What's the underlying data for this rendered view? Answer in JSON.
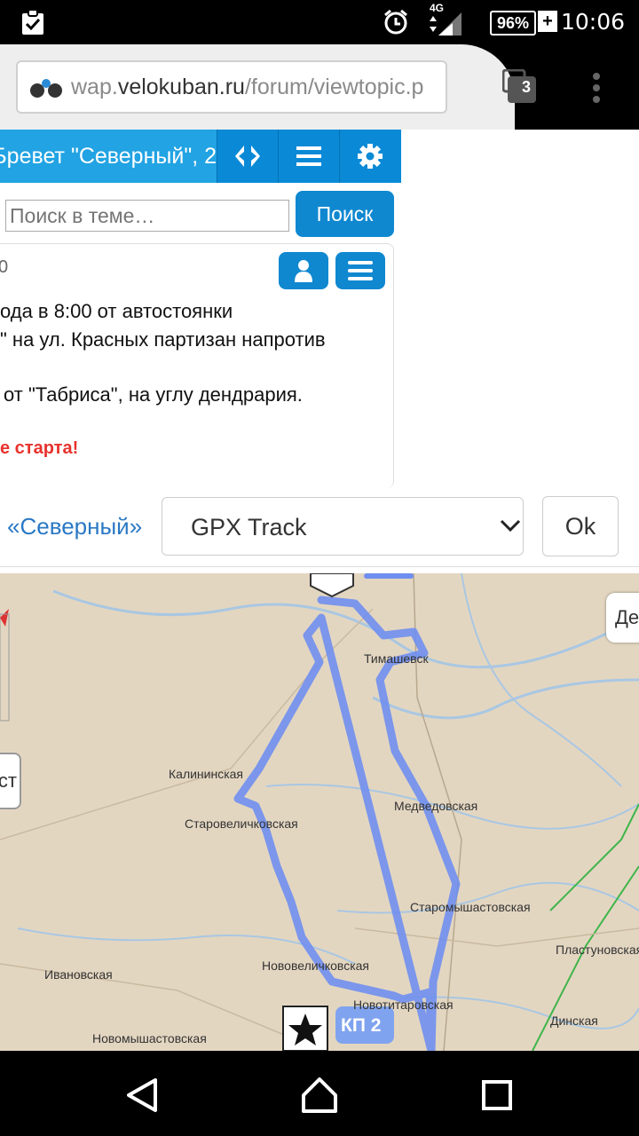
{
  "status_bar": {
    "time": "10:06",
    "battery": "96%",
    "network": "4G",
    "icons": [
      "clipboard-check-icon",
      "alarm-icon",
      "signal-icon",
      "battery-icon"
    ]
  },
  "browser": {
    "url_prefix": "wap.",
    "url_domain": "velokuban.ru",
    "url_path": "/forum/viewtopic.p",
    "tab_count": "3"
  },
  "topic": {
    "title": "Бревет \"Северный\", 2"
  },
  "search": {
    "placeholder": "Поиск в теме…",
    "button_label": "Поиск"
  },
  "post": {
    "meta": "0",
    "lines": [
      "ода в 8:00 от автостоянки",
      "\" на ул. Красных партизан напротив",
      "от \"Табриса\", на углу дендрария."
    ],
    "warning": "е старта!"
  },
  "gpx": {
    "link_label": "«Северный»",
    "select_value": "GPX Track",
    "ok_label": "Ok"
  },
  "map": {
    "labels": {
      "timashevsk": "Тимашевск",
      "kalininskaya": "Калининская",
      "starovelichkovskaya": "Старовеличковская",
      "medvedovskaya": "Медведовская",
      "staromyshastovskaya": "Старомышастовская",
      "plastunovskaya": "Пластуновская",
      "novovelichkovskaya": "Нововеличковская",
      "ivanovskaya": "Ивановская",
      "novotitarovskaya": "Новотитаровская",
      "dinskaya": "Динская",
      "novomyshastovskaya": "Новомышастовская"
    },
    "checkpoint": "КП 2",
    "right_ctrl": "Де",
    "left_ctrl": "ст",
    "colors": {
      "track": "#6f8ff0",
      "map_bg": "#e3d6c1",
      "water": "#a9c7e2"
    }
  },
  "colors": {
    "header_blue": "#0a8ad6",
    "title_blue": "#22a3e3",
    "button_blue": "#0f88d0",
    "link_blue": "#2a78c4",
    "warning_red": "#e8322c"
  }
}
